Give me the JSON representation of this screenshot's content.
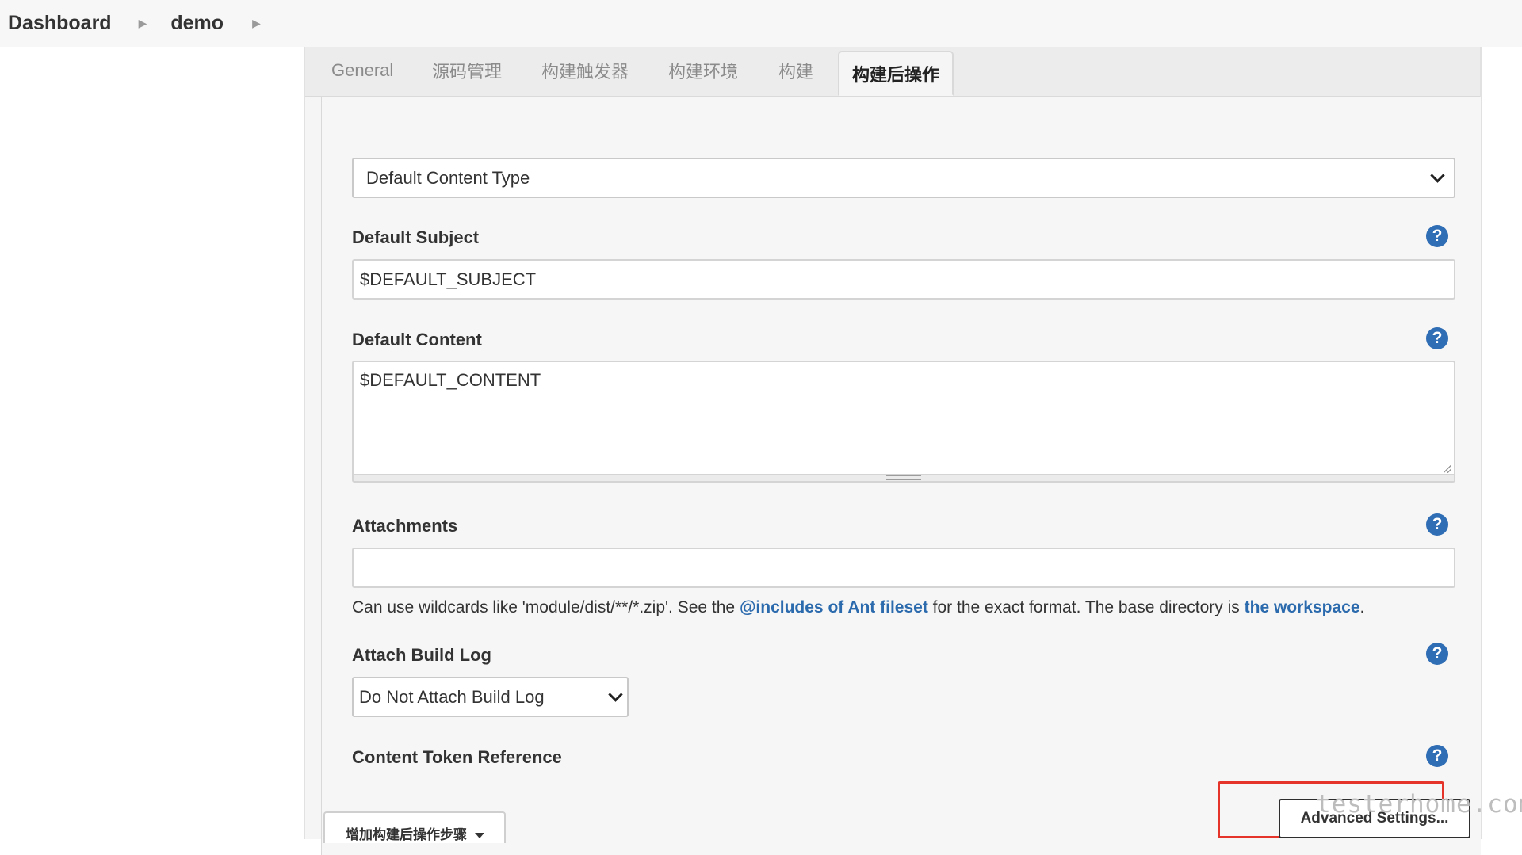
{
  "breadcrumb": {
    "items": [
      "Dashboard",
      "demo"
    ]
  },
  "tabs": [
    {
      "label": "General"
    },
    {
      "label": "源码管理"
    },
    {
      "label": "构建触发器"
    },
    {
      "label": "构建环境"
    },
    {
      "label": "构建"
    },
    {
      "label": "构建后操作"
    }
  ],
  "active_tab": "构建后操作",
  "form": {
    "content_type": {
      "value": "Default Content Type"
    },
    "default_subject": {
      "label": "Default Subject",
      "value": "$DEFAULT_SUBJECT"
    },
    "default_content": {
      "label": "Default Content",
      "value": "$DEFAULT_CONTENT"
    },
    "attachments": {
      "label": "Attachments",
      "value": "",
      "hint_before": "Can use wildcards like 'module/dist/**/*.zip'. See the ",
      "hint_link1": "@includes of Ant fileset",
      "hint_middle": " for the exact format. The base directory is ",
      "hint_link2": "the workspace",
      "hint_after": "."
    },
    "attach_build_log": {
      "label": "Attach Build Log",
      "value": "Do Not Attach Build Log"
    },
    "content_token_reference": {
      "label": "Content Token Reference"
    },
    "advanced_settings_label": "Advanced Settings..."
  },
  "add_post_build_step_label": "增加构建后操作步骤",
  "help_glyph": "?",
  "watermark": "testerhome.com",
  "colors": {
    "link": "#2b6aad",
    "help_icon": "#2f6db5",
    "highlight": "#e5342a"
  }
}
